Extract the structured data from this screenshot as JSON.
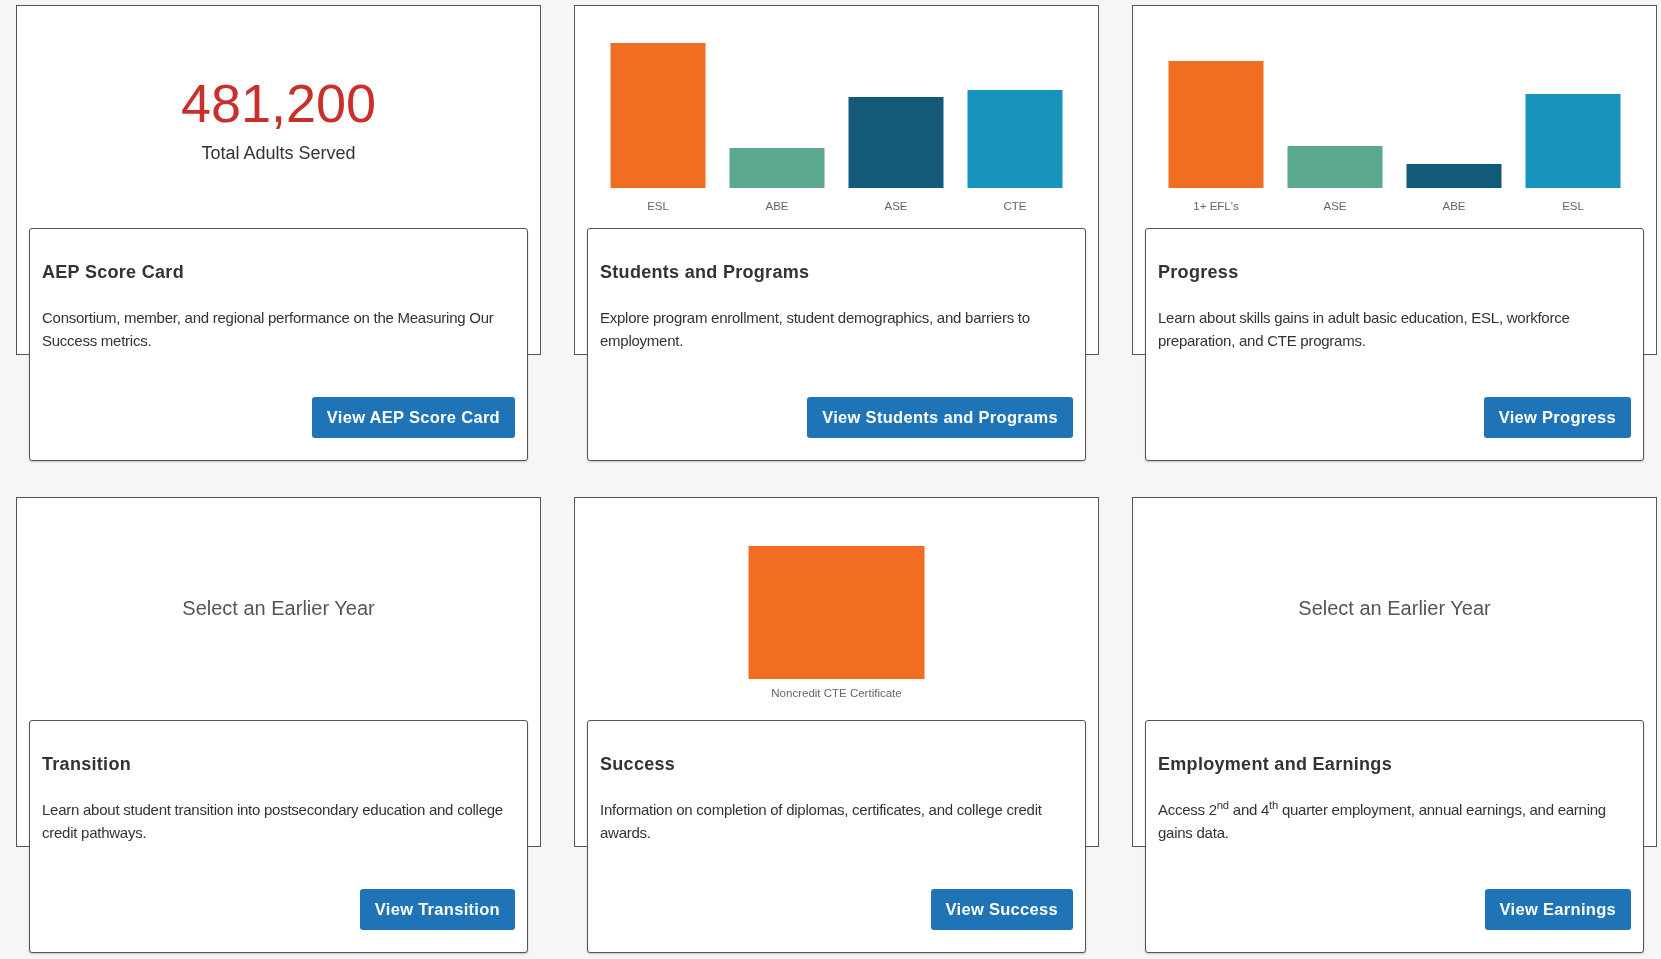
{
  "tiles": [
    {
      "visual": {
        "kind": "stat",
        "value": "481,200",
        "label": "Total Adults Served"
      },
      "title": "AEP Score Card",
      "description": "Consortium, member, and regional performance on the Measuring Our Success metrics.",
      "button": "View AEP Score Card"
    },
    {
      "visual": {
        "kind": "bars",
        "bars": [
          {
            "label": "ESL",
            "color": "#f06d22"
          },
          {
            "label": "ABE",
            "color": "#5ca790"
          },
          {
            "label": "ASE",
            "color": "#125a78"
          },
          {
            "label": "CTE",
            "color": "#1694bc"
          }
        ]
      },
      "title": "Students and Programs",
      "description": "Explore program enrollment, student demographics, and barriers to employment.",
      "button": "View Students and Programs"
    },
    {
      "visual": {
        "kind": "bars",
        "bars": [
          {
            "label": "1+ EFL's",
            "color": "#f06d22"
          },
          {
            "label": "ASE",
            "color": "#5ca790"
          },
          {
            "label": "ABE",
            "color": "#125a78"
          },
          {
            "label": "ESL",
            "color": "#1694bc"
          }
        ]
      },
      "title": "Progress",
      "description": "Learn about skills gains in adult basic education, ESL, workforce preparation, and CTE programs.",
      "button": "View Progress"
    },
    {
      "visual": {
        "kind": "message",
        "text": "Select an Earlier Year"
      },
      "title": "Transition",
      "description": "Learn about student transition into postsecondary education and college credit pathways.",
      "button": "View Transition"
    },
    {
      "visual": {
        "kind": "bars",
        "bars": [
          {
            "label": "Noncredit CTE Certificate",
            "color": "#f06d22"
          }
        ]
      },
      "title": "Success",
      "description": "Information on completion of diplomas, certificates, and college credit awards.",
      "button": "View Success"
    },
    {
      "visual": {
        "kind": "message",
        "text": "Select an Earlier Year"
      },
      "title": "Employment and Earnings",
      "description": "Access 2$^{nd}$ and 4$^{th}$ quarter employment, annual earnings, and earning gains data.",
      "button": "View Earnings"
    }
  ]
}
